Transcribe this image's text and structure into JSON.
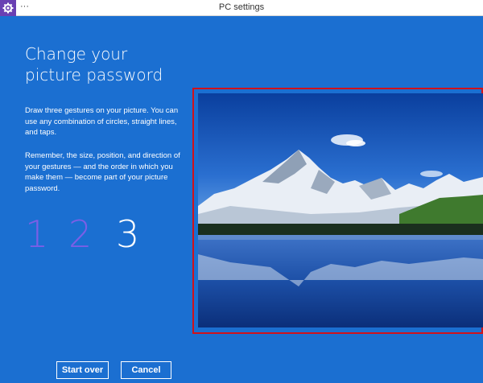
{
  "window": {
    "title": "PC settings",
    "menu": "···",
    "icon": "gear-icon"
  },
  "page": {
    "heading": "Change your picture password",
    "instructions_1": "Draw three gestures on your picture. You can use any combination of circles, straight lines, and taps.",
    "instructions_2": "Remember, the size, position, and direction of your gestures — and the order in which you make them — become part of your picture password.",
    "steps": [
      "1",
      "2",
      "3"
    ],
    "current_step": "3"
  },
  "buttons": {
    "start_over": "Start over",
    "cancel": "Cancel"
  },
  "colors": {
    "background": "#1b6fd1",
    "inactive_step": "#7a5fe6",
    "active_step": "#ffffff",
    "picture_border": "#d0121b",
    "app_icon": "#6a40b3"
  }
}
